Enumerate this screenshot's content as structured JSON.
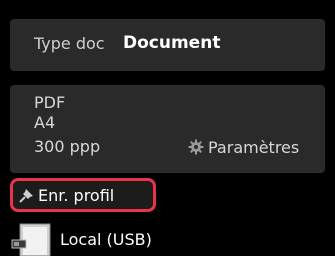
{
  "doc_type": {
    "label": "Type doc",
    "value": "Document"
  },
  "scan_settings": {
    "format": "PDF",
    "size": "A4",
    "resolution": "300 ppp",
    "settings_label": "Paramètres",
    "settings_icon": "gear-icon"
  },
  "save_profile": {
    "label": "Enr. profil",
    "icon": "pin-icon",
    "highlight_color": "#e8344a"
  },
  "destination": {
    "label": "Local (USB)",
    "icon": "usb-computer-icon"
  }
}
